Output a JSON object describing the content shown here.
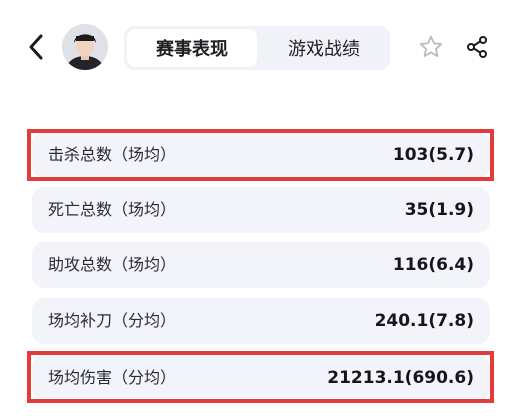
{
  "header": {
    "back_icon": "chevron-left-icon",
    "tabs": [
      {
        "label": "赛事表现",
        "active": true
      },
      {
        "label": "游戏战绩",
        "active": false
      }
    ],
    "star_icon": "star-outline-icon",
    "share_icon": "share-icon"
  },
  "stats": [
    {
      "label": "击杀总数（场均）",
      "value": "103(5.7)",
      "highlighted": true
    },
    {
      "label": "死亡总数（场均）",
      "value": "35(1.9)",
      "highlighted": false
    },
    {
      "label": "助攻总数（场均）",
      "value": "116(6.4)",
      "highlighted": false
    },
    {
      "label": "场均补刀（分均）",
      "value": "240.1(7.8)",
      "highlighted": false
    },
    {
      "label": "场均伤害（分均）",
      "value": "21213.1(690.6)",
      "highlighted": true
    }
  ],
  "colors": {
    "highlight_border": "#e23b3b",
    "row_background": "#f3f4f9",
    "tab_background": "#f1f2f7"
  }
}
